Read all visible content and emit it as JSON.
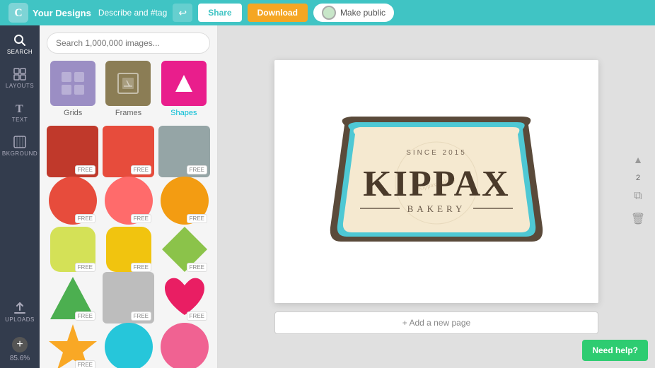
{
  "topbar": {
    "brand": "Canva",
    "page_title": "Your Designs",
    "describe_tag": "Describe and #tag",
    "share_label": "Share",
    "download_label": "Download",
    "make_public_label": "Make public"
  },
  "sidebar": {
    "items": [
      {
        "id": "search",
        "label": "SEARCH",
        "icon": "🔍"
      },
      {
        "id": "layouts",
        "label": "LAYOUTS",
        "icon": "⊞"
      },
      {
        "id": "text",
        "label": "TEXT",
        "icon": "T"
      },
      {
        "id": "background",
        "label": "BKGROUND",
        "icon": "▨"
      },
      {
        "id": "uploads",
        "label": "UPLOADS",
        "icon": "↑"
      }
    ],
    "zoom": "85.6%",
    "add_icon": "+"
  },
  "panel": {
    "search_placeholder": "Search 1,000,000 images...",
    "categories": [
      {
        "id": "grids",
        "label": "Grids"
      },
      {
        "id": "frames",
        "label": "Frames"
      },
      {
        "id": "shapes",
        "label": "Shapes",
        "active": true
      }
    ],
    "shapes": [
      {
        "color": "#c0392b",
        "free": true,
        "type": "rect"
      },
      {
        "color": "#e74c3c",
        "free": true,
        "type": "rect"
      },
      {
        "color": "#95a5a6",
        "free": false,
        "type": "rect"
      },
      {
        "color": "#e74c3c",
        "free": true,
        "type": "circle"
      },
      {
        "color": "#e84c4c",
        "free": true,
        "type": "circle"
      },
      {
        "color": "#f39c12",
        "free": false,
        "type": "circle"
      },
      {
        "color": "#d4e157",
        "free": true,
        "type": "rounded-rect"
      },
      {
        "color": "#f1c40f",
        "free": true,
        "type": "rounded-rect"
      },
      {
        "color": "#8bc34a",
        "free": false,
        "type": "diamond"
      },
      {
        "color": "#4caf50",
        "free": false,
        "type": "triangle"
      },
      {
        "color": "#bdbdbd",
        "free": true,
        "type": "rect"
      },
      {
        "color": "#e91e63",
        "free": true,
        "type": "heart"
      },
      {
        "color": "#f9a825",
        "free": false,
        "type": "star"
      },
      {
        "color": "#26c6da",
        "free": false,
        "type": "circle"
      },
      {
        "color": "#f06292",
        "free": false,
        "type": "circle"
      }
    ]
  },
  "canvas": {
    "add_page_label": "+ Add a new page",
    "page_number": "2"
  },
  "need_help": "Need help?"
}
